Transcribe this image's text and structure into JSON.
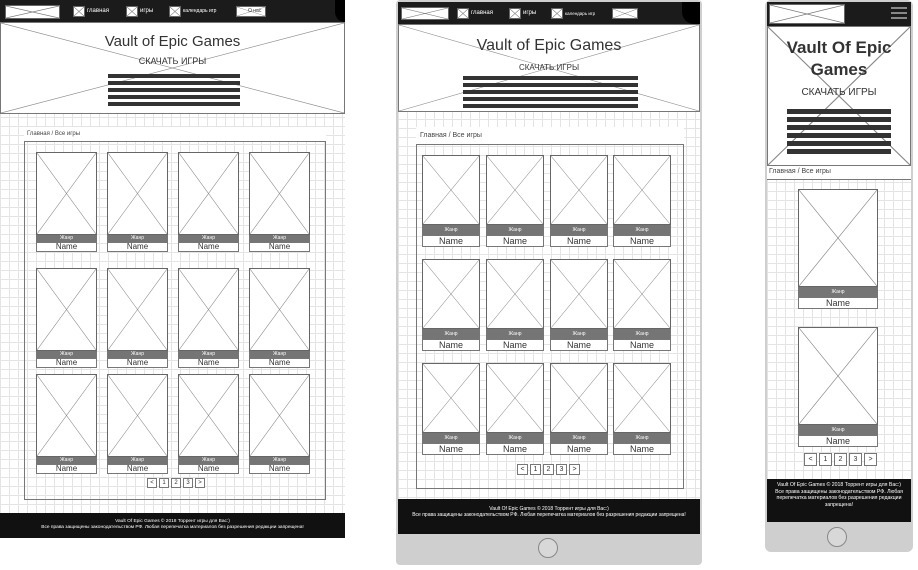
{
  "nav": {
    "home": "главная",
    "games": "игры",
    "calendar": "календарь игр",
    "about": "О нас"
  },
  "hero": {
    "title": "Vault of Epic Games",
    "title_mobile": "Vault Of Epic Games",
    "subtitle": "СКАЧАТЬ ИГРЫ"
  },
  "breadcrumb": "Главная / Все игры",
  "card": {
    "genre": "Жанр",
    "name": "Name"
  },
  "pager": [
    "<",
    "1",
    "2",
    "3",
    ">"
  ],
  "footer": {
    "line1": "Vault Of Epic Games © 2018 Торрент игры для Вас:)",
    "line2": "Все права защищены законодательством РФ. Любая перепечатка материалов без разрешения редакции запрещена!"
  },
  "colors": {
    "nav_bg": "#1b1b1b",
    "genre_bar": "#757575",
    "footer_bg": "#111111",
    "bezel": "#cfcfcf"
  }
}
